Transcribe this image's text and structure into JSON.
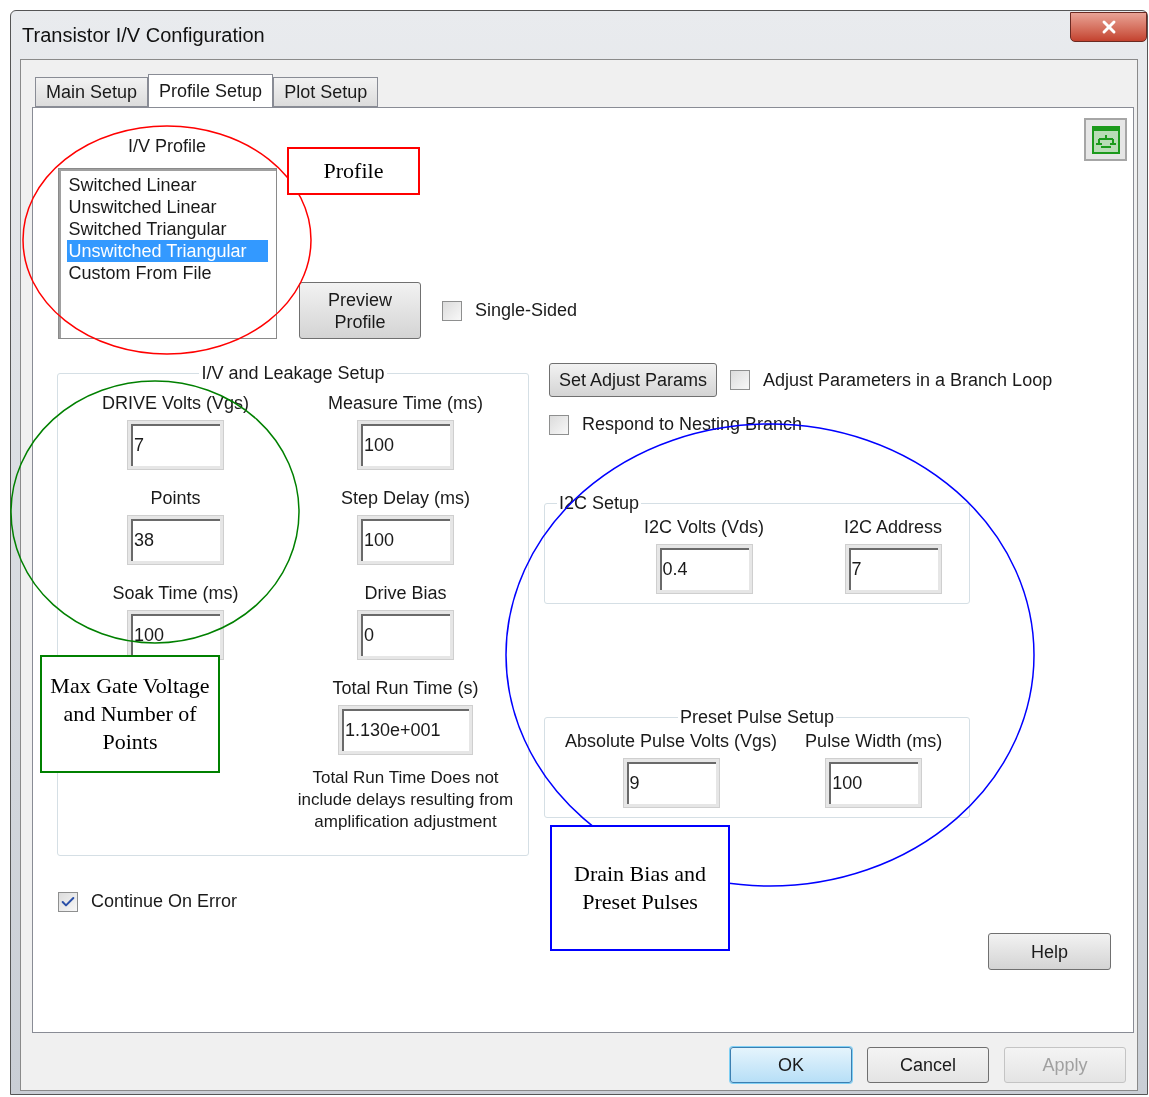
{
  "window": {
    "title": "Transistor I/V Configuration"
  },
  "tabs": [
    {
      "label": "Main Setup",
      "selected": false
    },
    {
      "label": "Profile Setup",
      "selected": true
    },
    {
      "label": "Plot Setup",
      "selected": false
    }
  ],
  "profile": {
    "label": "I/V Profile",
    "items": [
      {
        "label": "Switched Linear",
        "selected": false
      },
      {
        "label": "Unswitched Linear",
        "selected": false
      },
      {
        "label": "Switched Triangular",
        "selected": false
      },
      {
        "label": "Unswitched Triangular",
        "selected": true
      },
      {
        "label": "Custom From File",
        "selected": false
      }
    ]
  },
  "preview_button": "Preview Profile",
  "single_sided": {
    "label": "Single-Sided",
    "checked": false
  },
  "iv_leakage": {
    "title": "I/V and Leakage Setup",
    "left_fields": [
      {
        "label": "DRIVE Volts (Vgs)",
        "value": "7"
      },
      {
        "label": "Points",
        "value": "38"
      },
      {
        "label": "Soak Time (ms)",
        "value": "100"
      }
    ],
    "right_fields": [
      {
        "label": "Measure Time (ms)",
        "value": "100"
      },
      {
        "label": "Step Delay (ms)",
        "value": "100"
      },
      {
        "label": "Drive Bias",
        "value": "0"
      },
      {
        "label": "Total Run Time (s)",
        "value": "1.130e+001"
      }
    ],
    "note": "Total Run Time Does not include delays resulting from amplification adjustment"
  },
  "set_adjust_button": "Set Adjust Params",
  "adjust_branch_loop": {
    "label": "Adjust Parameters in a Branch Loop",
    "checked": false
  },
  "respond_nesting": {
    "label": "Respond to Nesting Branch",
    "checked": false
  },
  "i2c_setup": {
    "title": "I2C Setup",
    "fields": [
      {
        "label": "I2C Volts (Vds)",
        "value": "0.4"
      },
      {
        "label": "I2C Address",
        "value": "7"
      }
    ]
  },
  "preset_pulse_setup": {
    "title": "Preset Pulse Setup",
    "fields": [
      {
        "label": "Absolute Pulse Volts (Vgs)",
        "value": "9"
      },
      {
        "label": "Pulse Width (ms)",
        "value": "100"
      }
    ]
  },
  "continue_on_error": {
    "label": "Continue On Error",
    "checked": true
  },
  "help_button": "Help",
  "buttons": [
    {
      "label": "OK",
      "kind": "default",
      "disabled": false
    },
    {
      "label": "Cancel",
      "kind": "normal",
      "disabled": false
    },
    {
      "label": "Apply",
      "kind": "normal",
      "disabled": true
    }
  ],
  "annotations": [
    {
      "text": "Profile",
      "color": "#ff0000"
    },
    {
      "text": "Max Gate Voltage and Number of Points",
      "color": "#008000"
    },
    {
      "text": "Drain Bias and Preset Pulses",
      "color": "#0000ff"
    }
  ]
}
